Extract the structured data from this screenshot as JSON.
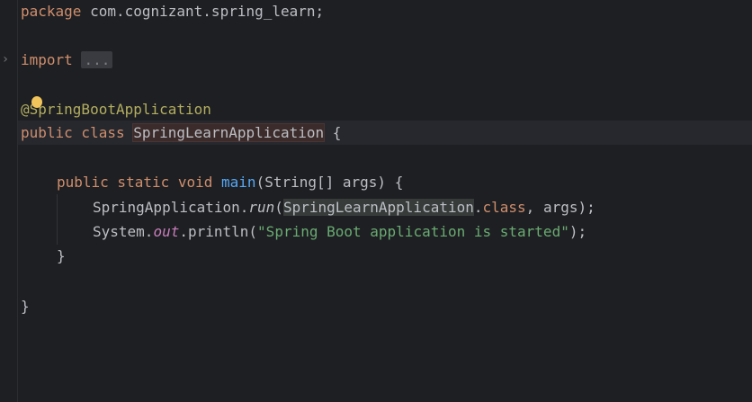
{
  "code": {
    "line1": {
      "kw": "package",
      "rest": " com.cognizant.spring_learn;"
    },
    "line3": {
      "kw": "import",
      "folded": "..."
    },
    "line5": {
      "annotation": "@SpringBootApplication"
    },
    "line6": {
      "kw": "public class",
      "classname": "SpringLearnApplication",
      "rest": " {"
    },
    "line8": {
      "kw": "public static void",
      "method": "main",
      "rest": "(String[] args) {"
    },
    "line9": {
      "target": "SpringApplication.",
      "method": "run",
      "open": "(",
      "ref": "SpringLearnApplication",
      "dot": ".",
      "kw": "class",
      "rest": ", args);"
    },
    "line10": {
      "target": "System.",
      "field": "out",
      "call": ".println(",
      "string": "\"Spring Boot application is started\"",
      "rest": ");"
    },
    "line11": {
      "text": "}"
    },
    "line13": {
      "text": "}"
    }
  },
  "icons": {
    "fold": "chevron-right-icon",
    "intention": "lightbulb-icon"
  }
}
